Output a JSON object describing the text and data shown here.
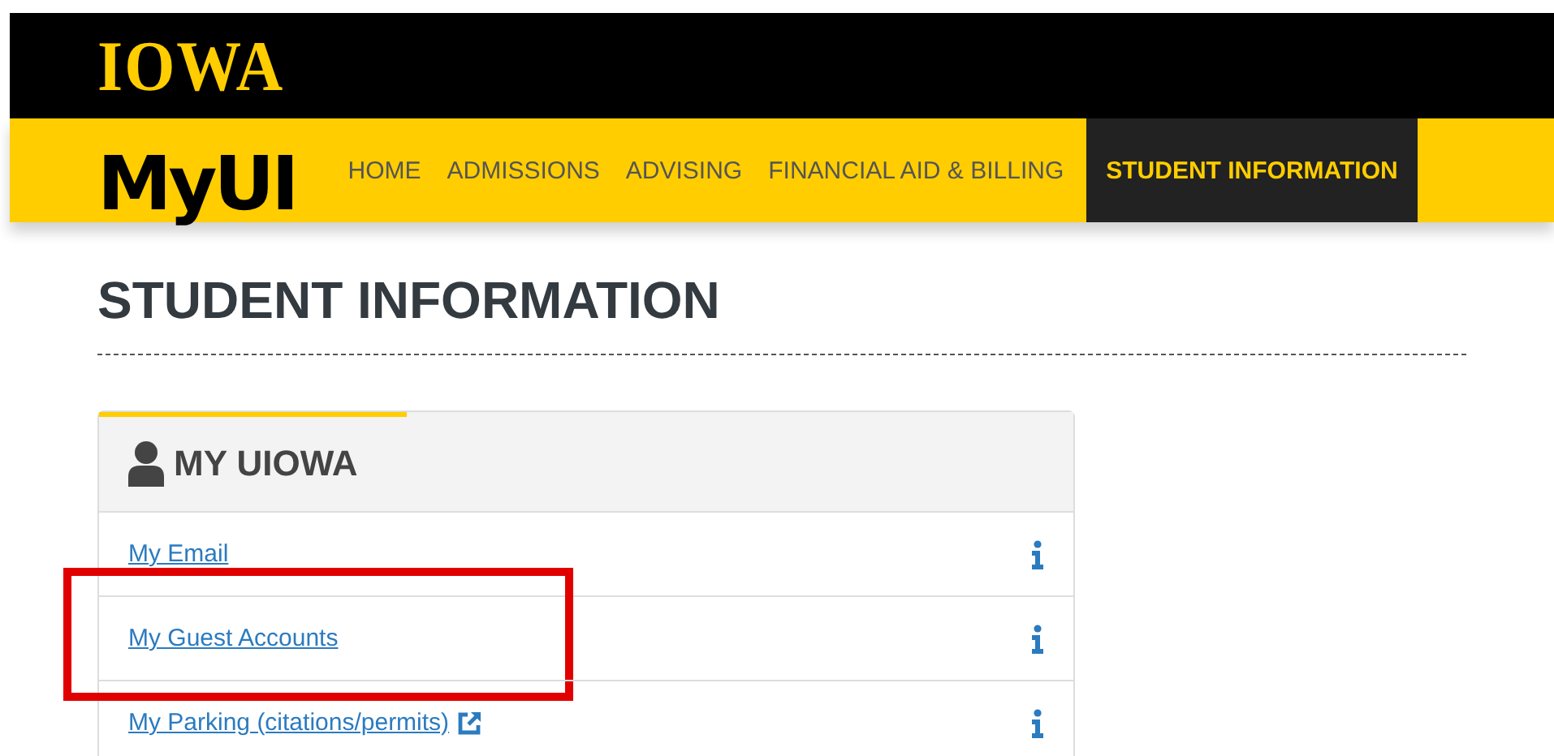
{
  "brand": {
    "wordmark": "IOWA",
    "app_logo": "MyUI"
  },
  "nav": [
    {
      "label": "HOME",
      "selected": false
    },
    {
      "label": "ADMISSIONS",
      "selected": false
    },
    {
      "label": "ADVISING",
      "selected": false
    },
    {
      "label": "FINANCIAL AID & BILLING",
      "selected": false
    },
    {
      "label": "STUDENT INFORMATION",
      "selected": true
    }
  ],
  "page_title": "STUDENT INFORMATION",
  "card": {
    "title": "MY UIOWA",
    "links": [
      {
        "label": "My Email",
        "external": false,
        "highlighted": false
      },
      {
        "label": "My Guest Accounts",
        "external": false,
        "highlighted": true
      },
      {
        "label": "My Parking (citations/permits)",
        "external": true,
        "highlighted": false
      }
    ]
  }
}
